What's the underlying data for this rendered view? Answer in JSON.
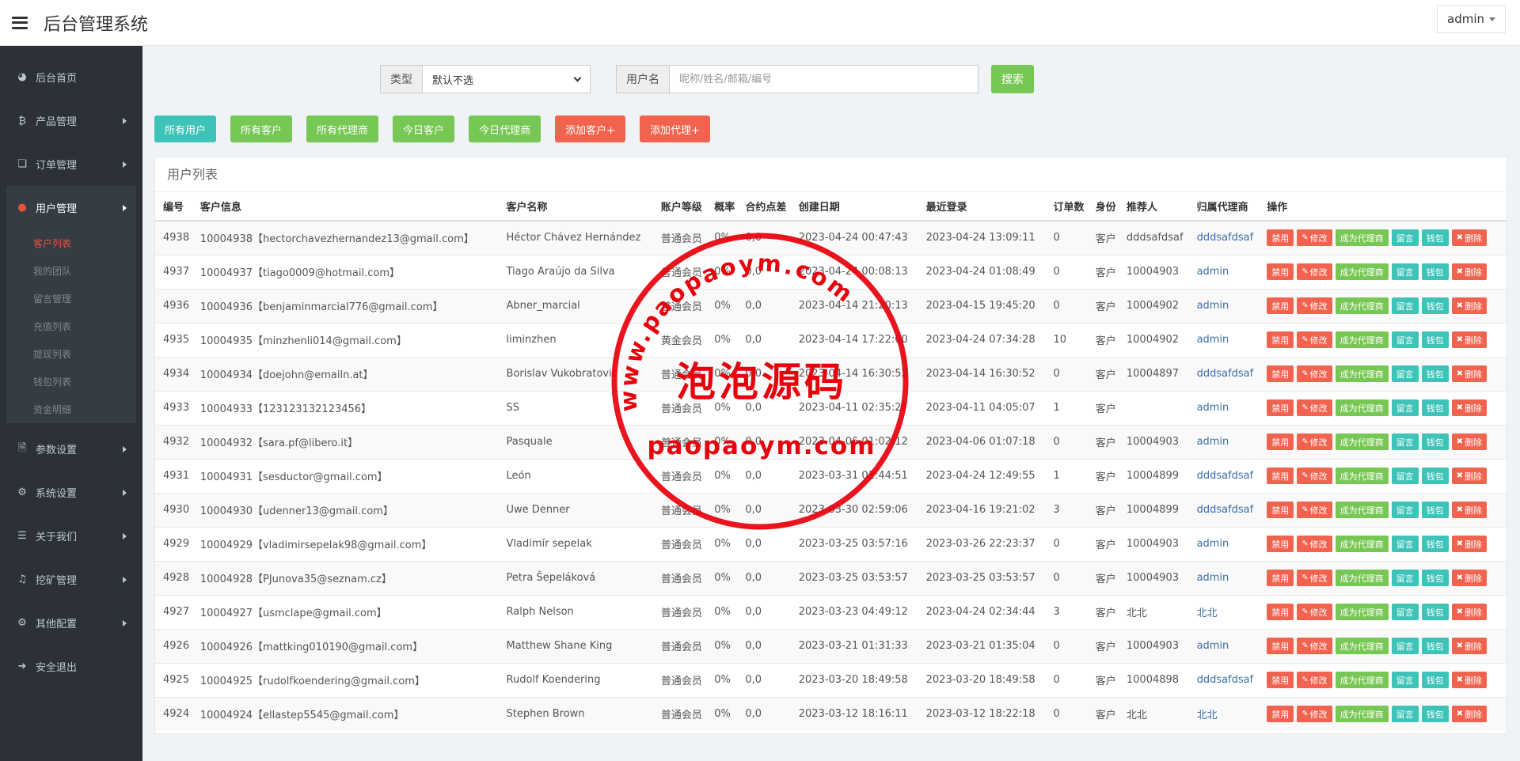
{
  "header": {
    "title": "后台管理系统",
    "user": "admin"
  },
  "sidebar": {
    "items": [
      {
        "label": "后台首页",
        "icon": "dashboard-icon"
      },
      {
        "label": "产品管理",
        "icon": "bitcoin-icon"
      },
      {
        "label": "订单管理",
        "icon": "copy-icon"
      },
      {
        "label": "用户管理",
        "icon": "user-icon"
      },
      {
        "label": "参数设置",
        "icon": "file-icon"
      },
      {
        "label": "系统设置",
        "icon": "gears-icon"
      },
      {
        "label": "关于我们",
        "icon": "list-icon"
      },
      {
        "label": "挖矿管理",
        "icon": "bell-icon"
      },
      {
        "label": "其他配置",
        "icon": "gear-icon"
      },
      {
        "label": "安全退出",
        "icon": "sign-out-icon"
      }
    ],
    "submenu": [
      "客户列表",
      "我的团队",
      "留言管理",
      "充值列表",
      "提现列表",
      "钱包列表",
      "资金明细"
    ]
  },
  "search": {
    "type_label": "类型",
    "type_value": "默认不选",
    "username_label": "用户名",
    "username_placeholder": "昵称/姓名/邮箱/编号",
    "search_button": "搜索"
  },
  "actions": [
    "所有用户",
    "所有客户",
    "所有代理商",
    "今日客户",
    "今日代理商",
    "添加客户+",
    "添加代理+"
  ],
  "panel_title": "用户列表",
  "table": {
    "columns": [
      "编号",
      "客户信息",
      "客户名称",
      "账户等级",
      "概率",
      "合约点差",
      "创建日期",
      "最近登录",
      "订单数",
      "身份",
      "推荐人",
      "归属代理商",
      "操作"
    ],
    "row_actions": [
      "禁用",
      "修改",
      "成为代理商",
      "留言",
      "钱包",
      "删除"
    ],
    "rows": [
      [
        "4938",
        "10004938【hectorchavezhernandez13@gmail.com】",
        "Héctor Chávez Hernández",
        "普通会员",
        "0%",
        "0,0",
        "2023-04-24 00:47:43",
        "2023-04-24 13:09:11",
        "0",
        "客户",
        "dddsafdsaf",
        "dddsafdsaf"
      ],
      [
        "4937",
        "10004937【tiago0009@hotmail.com】",
        "Tiago Araújo da Silva",
        "普通会员",
        "0%",
        "0,0",
        "2023-04-24 00:08:13",
        "2023-04-24 01:08:49",
        "0",
        "客户",
        "10004903",
        "admin"
      ],
      [
        "4936",
        "10004936【benjaminmarcial776@gmail.com】",
        "Abner_marcial",
        "普通会员",
        "0%",
        "0,0",
        "2023-04-14 21:20:13",
        "2023-04-15 19:45:20",
        "0",
        "客户",
        "10004902",
        "admin"
      ],
      [
        "4935",
        "10004935【minzhenli014@gmail.com】",
        "liminzhen",
        "黄金会员",
        "0%",
        "0,0",
        "2023-04-14 17:22:00",
        "2023-04-24 07:34:28",
        "10",
        "客户",
        "10004902",
        "admin"
      ],
      [
        "4934",
        "10004934【doejohn@emailn.at】",
        "Borislav Vukobratovic",
        "普通会员",
        "0%",
        "0,0",
        "2023-04-14 16:30:52",
        "2023-04-14 16:30:52",
        "0",
        "客户",
        "10004897",
        "dddsafdsaf"
      ],
      [
        "4933",
        "10004933【123123132123456】",
        "SS",
        "普通会员",
        "0%",
        "0,0",
        "2023-04-11 02:35:27",
        "2023-04-11 04:05:07",
        "1",
        "客户",
        "",
        "admin"
      ],
      [
        "4932",
        "10004932【sara.pf@libero.it】",
        "Pasquale",
        "普通会员",
        "0%",
        "0,0",
        "2023-04-06 01:02:12",
        "2023-04-06 01:07:18",
        "0",
        "客户",
        "10004903",
        "admin"
      ],
      [
        "4931",
        "10004931【sesductor@gmail.com】",
        "León",
        "普通会员",
        "0%",
        "0,0",
        "2023-03-31 01:44:51",
        "2023-04-24 12:49:55",
        "1",
        "客户",
        "10004899",
        "dddsafdsaf"
      ],
      [
        "4930",
        "10004930【udenner13@gmail.com】",
        "Uwe Denner",
        "普通会员",
        "0%",
        "0,0",
        "2023-03-30 02:59:06",
        "2023-04-16 19:21:02",
        "3",
        "客户",
        "10004899",
        "dddsafdsaf"
      ],
      [
        "4929",
        "10004929【vladimirsepelak98@gmail.com】",
        "Vladimír sepelak",
        "普通会员",
        "0%",
        "0,0",
        "2023-03-25 03:57:16",
        "2023-03-26 22:23:37",
        "0",
        "客户",
        "10004903",
        "admin"
      ],
      [
        "4928",
        "10004928【PJunova35@seznam.cz】",
        "Petra Šepeláková",
        "普通会员",
        "0%",
        "0,0",
        "2023-03-25 03:53:57",
        "2023-03-25 03:53:57",
        "0",
        "客户",
        "10004903",
        "admin"
      ],
      [
        "4927",
        "10004927【usmclape@gmail.com】",
        "Ralph Nelson",
        "普通会员",
        "0%",
        "0,0",
        "2023-03-23 04:49:12",
        "2023-04-24 02:34:44",
        "3",
        "客户",
        "北北",
        "北北"
      ],
      [
        "4926",
        "10004926【mattking010190@gmail.com】",
        "Matthew Shane King",
        "普通会员",
        "0%",
        "0,0",
        "2023-03-21 01:31:33",
        "2023-03-21 01:35:04",
        "0",
        "客户",
        "10004903",
        "admin"
      ],
      [
        "4925",
        "10004925【rudolfkoendering@gmail.com】",
        "Rudolf Koendering",
        "普通会员",
        "0%",
        "0,0",
        "2023-03-20 18:49:58",
        "2023-03-20 18:49:58",
        "0",
        "客户",
        "10004898",
        "dddsafdsaf"
      ],
      [
        "4924",
        "10004924【ellastep5545@gmail.com】",
        "Stephen Brown",
        "普通会员",
        "0%",
        "0,0",
        "2023-03-12 18:16:11",
        "2023-03-12 18:22:18",
        "0",
        "客户",
        "北北",
        "北北"
      ]
    ]
  },
  "watermark": {
    "top": "www.paopaoym.com",
    "middle": "泡泡源码",
    "bottom": "paopaoym.com",
    "color": "#e8000b"
  }
}
